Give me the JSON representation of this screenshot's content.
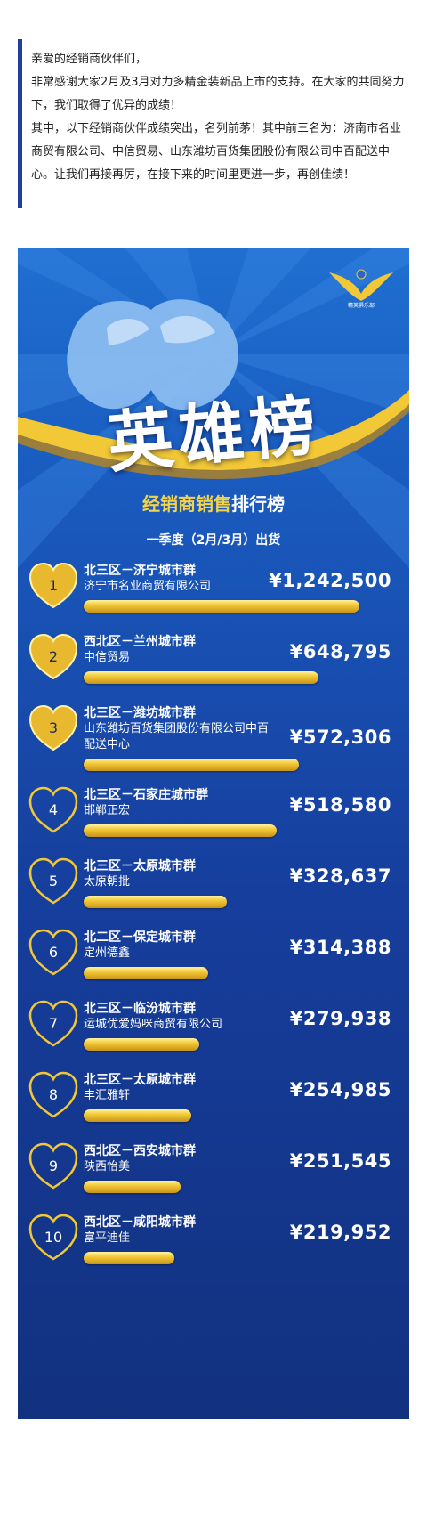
{
  "intro": {
    "lines": [
      "亲爱的经销商伙伴们，",
      "非常感谢大家2月及3月对力多精金装新品上市的支持。在大家的共同努力下，我们取得了优异的成绩！",
      "其中，以下经销商伙伴成绩突出，名列前茅！其中前三名为：济南市名业商贸有限公司、中信贸易、山东潍坊百货集团股份有限公司中百配送中心。让我们再接再厉，在接下来的时间里更进一步，再创佳绩！"
    ]
  },
  "poster": {
    "logo_text": "精英俱乐部",
    "hero_title": "英雄榜",
    "subtitle_gold": "经销商销售",
    "subtitle_white": "排行榜",
    "period": "一季度（2月/3月）出货",
    "colors": {
      "gold": "#f2c836",
      "blue_dark": "#12317f",
      "blue_light": "#1f6fd1"
    }
  },
  "ranking": [
    {
      "rank": "1",
      "region": "北三区－济宁城市群",
      "company": "济宁市名业商贸有限公司",
      "amount": "¥1,242,500",
      "share": 1.0
    },
    {
      "rank": "2",
      "region": "西北区－兰州城市群",
      "company": "中信贸易",
      "amount": "¥648,795",
      "share": 0.85
    },
    {
      "rank": "3",
      "region": "北三区－潍坊城市群",
      "company": "山东潍坊百货集团股份有限公司中百配送中心",
      "amount": "¥572,306",
      "share": 0.78
    },
    {
      "rank": "4",
      "region": "北三区－石家庄城市群",
      "company": "邯郸正宏",
      "amount": "¥518,580",
      "share": 0.7
    },
    {
      "rank": "5",
      "region": "北三区－太原城市群",
      "company": "太原朝批",
      "amount": "¥328,637",
      "share": 0.52
    },
    {
      "rank": "6",
      "region": "北二区－保定城市群",
      "company": "定州德鑫",
      "amount": "¥314,388",
      "share": 0.45
    },
    {
      "rank": "7",
      "region": "北三区－临汾城市群",
      "company": "运城优爱妈咪商贸有限公司",
      "amount": "¥279,938",
      "share": 0.42
    },
    {
      "rank": "8",
      "region": "北三区－太原城市群",
      "company": "丰汇雅轩",
      "amount": "¥254,985",
      "share": 0.39
    },
    {
      "rank": "9",
      "region": "西北区－西安城市群",
      "company": "陕西怡美",
      "amount": "¥251,545",
      "share": 0.35
    },
    {
      "rank": "10",
      "region": "西北区－咸阳城市群",
      "company": "富平迪佳",
      "amount": "¥219,952",
      "share": 0.33
    }
  ]
}
